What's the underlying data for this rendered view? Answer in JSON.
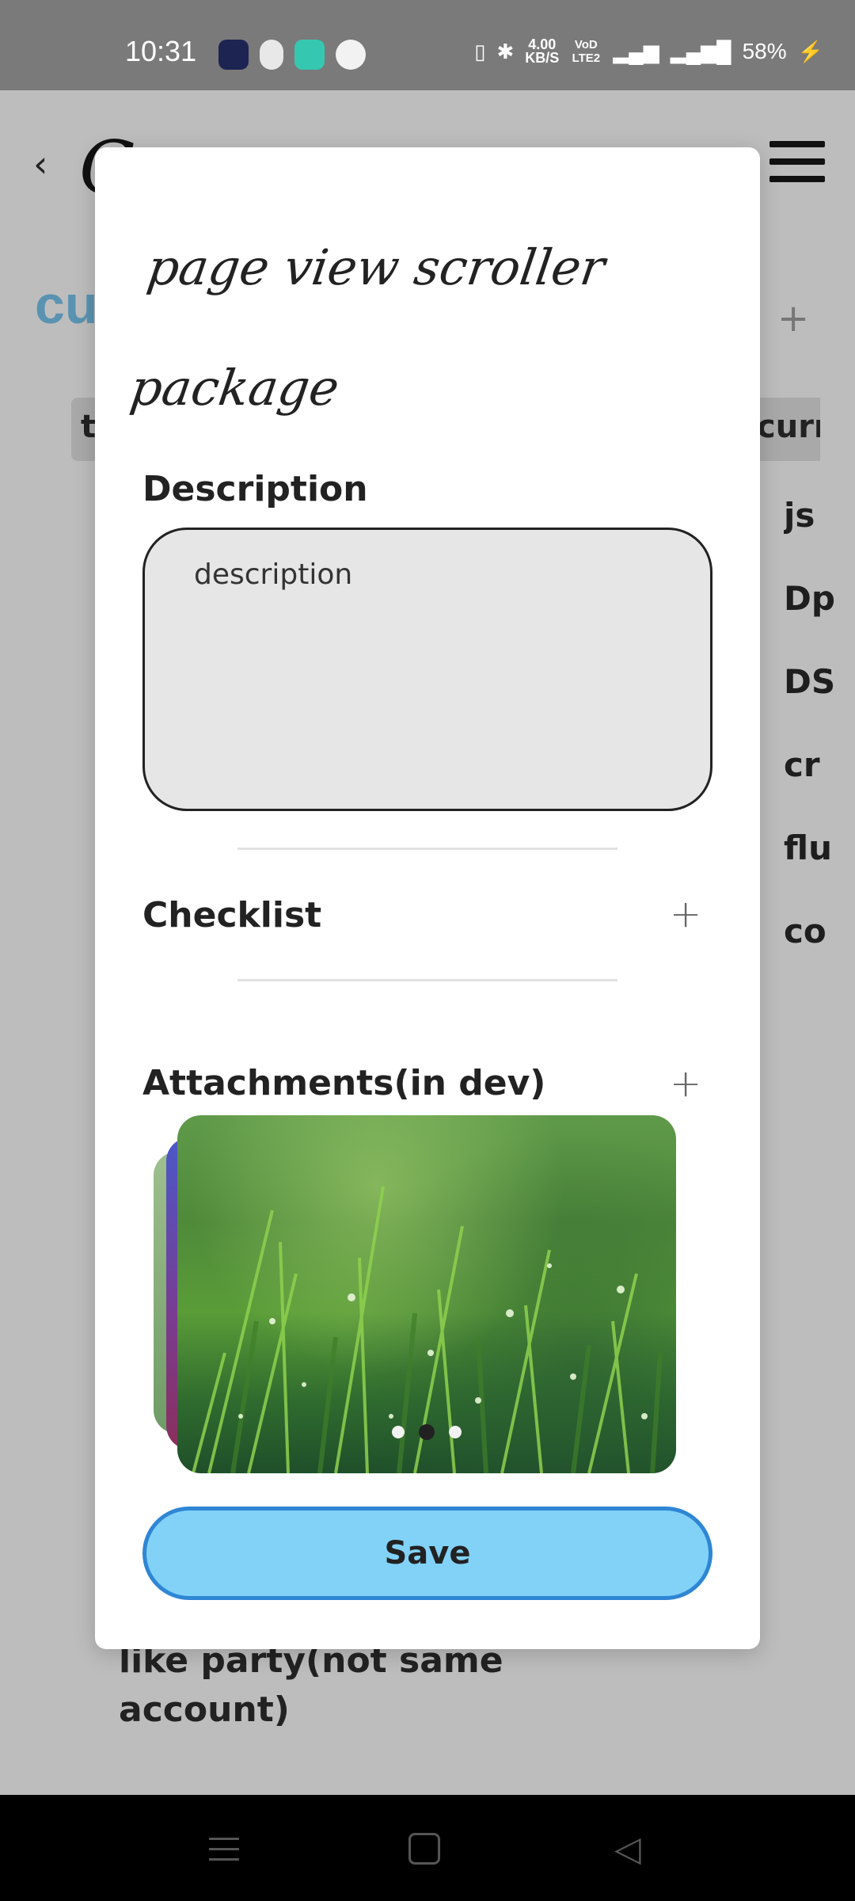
{
  "status_bar": {
    "time": "10:31",
    "speed_value": "4.00",
    "speed_unit": "KB/S",
    "volte": "VoD LTE2",
    "battery": "58%",
    "icons": [
      "vibrate-icon",
      "bluetooth-icon",
      "4g-signal-icon",
      "signal-icon",
      "charging-icon"
    ]
  },
  "background": {
    "heading_fragment": "cu",
    "chip_left": "t",
    "chip_right": "curr",
    "list_fragments": [
      "js",
      "Dp",
      "DS",
      "cr",
      "flu",
      "co"
    ],
    "bottom_text": "like party(not same account)"
  },
  "modal": {
    "title": "page view scroller package",
    "description_label": "Description",
    "description_placeholder": "description",
    "checklist_label": "Checklist",
    "attachments_label": "Attachments(in dev)",
    "add_symbol": "+",
    "gallery": {
      "page_count": 3,
      "active_page": 2
    },
    "save_label": "Save"
  },
  "colors": {
    "accent": "#82d2f8",
    "accent_border": "#2f86d4",
    "background_heading": "#5a93b1"
  }
}
